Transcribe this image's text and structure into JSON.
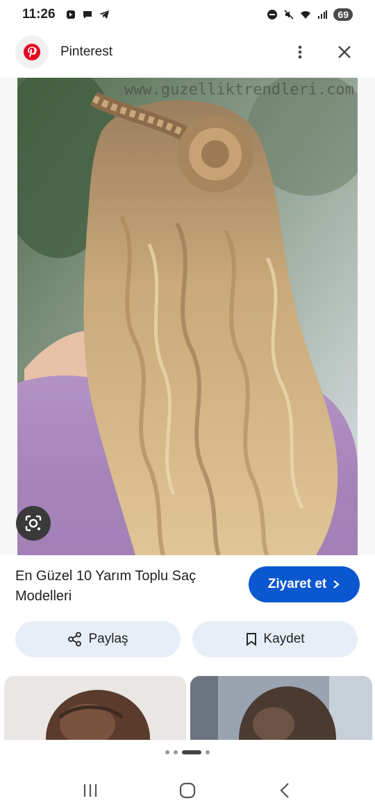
{
  "status_bar": {
    "time": "11:26",
    "battery": "69",
    "left_icons": [
      "data-saver-icon",
      "chat-icon",
      "telegram-icon"
    ],
    "right_icons": [
      "dnd-icon",
      "mute-icon",
      "wifi-icon",
      "signal-icon"
    ]
  },
  "header": {
    "site_name": "Pinterest",
    "icons": [
      "pinterest-logo",
      "more-vert-icon",
      "close-icon"
    ]
  },
  "image": {
    "watermark": "www.guzelliktrendleri.com",
    "lens_icon": "google-lens-icon"
  },
  "title": "En Güzel 10 Yarım Toplu Saç Modelleri",
  "visit_button": "Ziyaret et",
  "actions": {
    "share_label": "Paylaş",
    "save_label": "Kaydet"
  },
  "pagination": {
    "count": 4,
    "active_index": 2
  },
  "colors": {
    "accent": "#0b57d0",
    "pill_bg": "#e8eef8",
    "pinterest_red": "#e60023"
  }
}
